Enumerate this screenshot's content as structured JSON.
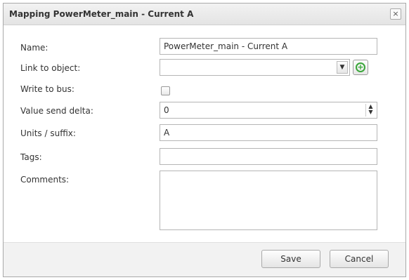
{
  "dialog": {
    "title": "Mapping PowerMeter_main - Current A",
    "close_label": "×"
  },
  "form": {
    "name_label": "Name:",
    "name_value": "PowerMeter_main - Current A",
    "link_label": "Link to object:",
    "link_value": "",
    "write_label": "Write to bus:",
    "write_checked": false,
    "delta_label": "Value send delta:",
    "delta_value": "0",
    "units_label": "Units / suffix:",
    "units_value": "A",
    "tags_label": "Tags:",
    "tags_value": "",
    "comments_label": "Comments:",
    "comments_value": ""
  },
  "footer": {
    "save_label": "Save",
    "cancel_label": "Cancel"
  },
  "colors": {
    "accent_green": "#3aa63a",
    "footer_bg": "#f2f2f2"
  }
}
